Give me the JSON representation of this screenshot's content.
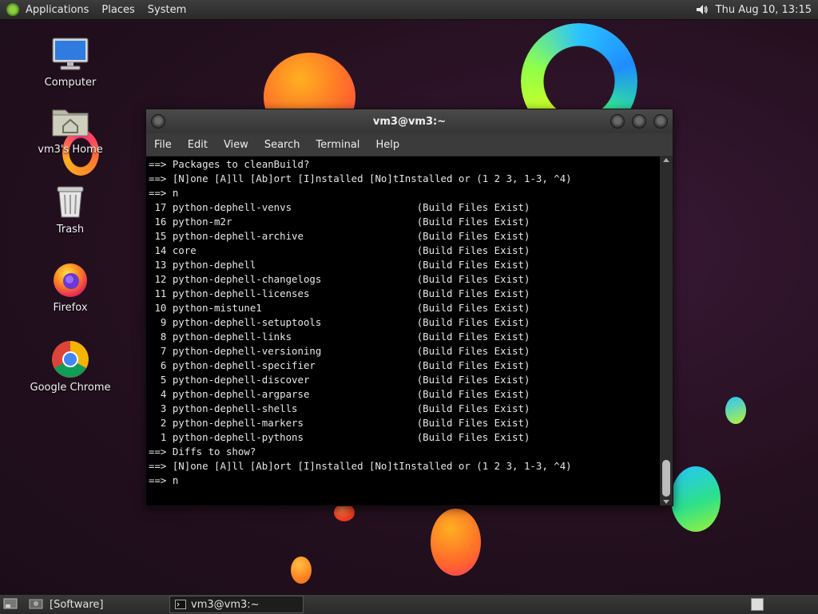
{
  "top_panel": {
    "menus": [
      "Applications",
      "Places",
      "System"
    ],
    "clock": "Thu Aug 10, 13:15"
  },
  "desktop_icons": [
    {
      "label": "Computer",
      "icon": "computer-icon"
    },
    {
      "label": "vm3's Home",
      "icon": "home-folder-icon"
    },
    {
      "label": "Trash",
      "icon": "trash-icon"
    },
    {
      "label": "Firefox",
      "icon": "firefox-icon"
    },
    {
      "label": "Google Chrome",
      "icon": "chrome-icon"
    }
  ],
  "terminal": {
    "title": "vm3@vm3:~",
    "menu": [
      "File",
      "Edit",
      "View",
      "Search",
      "Terminal",
      "Help"
    ],
    "lines": [
      "==> Packages to cleanBuild?",
      "==> [N]one [A]ll [Ab]ort [I]nstalled [No]tInstalled or (1 2 3, 1-3, ^4)",
      "==> n",
      " 17 python-dephell-venvs                     (Build Files Exist)",
      " 16 python-m2r                               (Build Files Exist)",
      " 15 python-dephell-archive                   (Build Files Exist)",
      " 14 core                                     (Build Files Exist)",
      " 13 python-dephell                           (Build Files Exist)",
      " 12 python-dephell-changelogs                (Build Files Exist)",
      " 11 python-dephell-licenses                  (Build Files Exist)",
      " 10 python-mistune1                          (Build Files Exist)",
      "  9 python-dephell-setuptools                (Build Files Exist)",
      "  8 python-dephell-links                     (Build Files Exist)",
      "  7 python-dephell-versioning                (Build Files Exist)",
      "  6 python-dephell-specifier                 (Build Files Exist)",
      "  5 python-dephell-discover                  (Build Files Exist)",
      "  4 python-dephell-argparse                  (Build Files Exist)",
      "  3 python-dephell-shells                    (Build Files Exist)",
      "  2 python-dephell-markers                   (Build Files Exist)",
      "  1 python-dephell-pythons                   (Build Files Exist)",
      "==> Diffs to show?",
      "==> [N]one [A]ll [Ab]ort [I]nstalled [No]tInstalled or (1 2 3, 1-3, ^4)",
      "==> n"
    ]
  },
  "bottom_panel": {
    "tasks": [
      {
        "label": "[Software]",
        "icon": "software-window-icon"
      },
      {
        "label": "vm3@vm3:~",
        "icon": "terminal-window-icon"
      }
    ]
  },
  "colors": {
    "terminal_bg": "#000000",
    "terminal_fg": "#e6e6e6",
    "panel_bg": "#2e2e2e",
    "wallpaper_bg": "#24101f"
  }
}
